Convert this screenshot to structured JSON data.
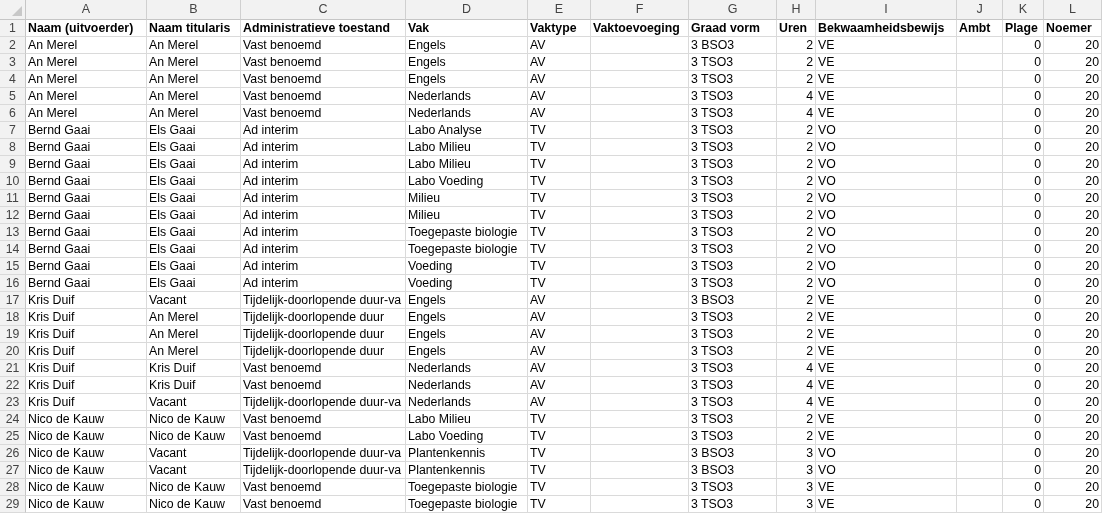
{
  "columns": [
    {
      "letter": "A",
      "heading": "Naam (uitvoerder)",
      "kind": "text"
    },
    {
      "letter": "B",
      "heading": "Naam titularis",
      "kind": "text"
    },
    {
      "letter": "C",
      "heading": "Administratieve toestand",
      "kind": "text"
    },
    {
      "letter": "D",
      "heading": "Vak",
      "kind": "text"
    },
    {
      "letter": "E",
      "heading": "Vaktype",
      "kind": "text"
    },
    {
      "letter": "F",
      "heading": "Vaktoevoeging",
      "kind": "text"
    },
    {
      "letter": "G",
      "heading": "Graad vorm",
      "kind": "text"
    },
    {
      "letter": "H",
      "heading": "Uren",
      "kind": "number"
    },
    {
      "letter": "I",
      "heading": "Bekwaamheidsbewijs",
      "kind": "text"
    },
    {
      "letter": "J",
      "heading": "Ambt",
      "kind": "text"
    },
    {
      "letter": "K",
      "heading": "Plage",
      "kind": "number"
    },
    {
      "letter": "L",
      "heading": "Noemer",
      "kind": "number"
    }
  ],
  "heading_row_number": "1",
  "rows": [
    {
      "number": "2",
      "cells": [
        "An Merel",
        "An Merel",
        "Vast benoemd",
        "Engels",
        "AV",
        null,
        "3 BSO3",
        "2",
        "VE",
        null,
        "0",
        "20"
      ]
    },
    {
      "number": "3",
      "cells": [
        "An Merel",
        "An Merel",
        "Vast benoemd",
        "Engels",
        "AV",
        null,
        "3 TSO3",
        "2",
        "VE",
        null,
        "0",
        "20"
      ]
    },
    {
      "number": "4",
      "cells": [
        "An Merel",
        "An Merel",
        "Vast benoemd",
        "Engels",
        "AV",
        null,
        "3 TSO3",
        "2",
        "VE",
        null,
        "0",
        "20"
      ]
    },
    {
      "number": "5",
      "cells": [
        "An Merel",
        "An Merel",
        "Vast benoemd",
        "Nederlands",
        "AV",
        null,
        "3 TSO3",
        "4",
        "VE",
        null,
        "0",
        "20"
      ]
    },
    {
      "number": "6",
      "cells": [
        "An Merel",
        "An Merel",
        "Vast benoemd",
        "Nederlands",
        "AV",
        null,
        "3 TSO3",
        "4",
        "VE",
        null,
        "0",
        "20"
      ]
    },
    {
      "number": "7",
      "cells": [
        "Bernd Gaai",
        "Els Gaai",
        "Ad interim",
        "Labo Analyse",
        "TV",
        null,
        "3 TSO3",
        "2",
        "VO",
        null,
        "0",
        "20"
      ]
    },
    {
      "number": "8",
      "cells": [
        "Bernd Gaai",
        "Els Gaai",
        "Ad interim",
        "Labo Milieu",
        "TV",
        null,
        "3 TSO3",
        "2",
        "VO",
        null,
        "0",
        "20"
      ]
    },
    {
      "number": "9",
      "cells": [
        "Bernd Gaai",
        "Els Gaai",
        "Ad interim",
        "Labo Milieu",
        "TV",
        null,
        "3 TSO3",
        "2",
        "VO",
        null,
        "0",
        "20"
      ]
    },
    {
      "number": "10",
      "cells": [
        "Bernd Gaai",
        "Els Gaai",
        "Ad interim",
        "Labo Voeding",
        "TV",
        null,
        "3 TSO3",
        "2",
        "VO",
        null,
        "0",
        "20"
      ]
    },
    {
      "number": "11",
      "cells": [
        "Bernd Gaai",
        "Els Gaai",
        "Ad interim",
        "Milieu",
        "TV",
        null,
        "3 TSO3",
        "2",
        "VO",
        null,
        "0",
        "20"
      ]
    },
    {
      "number": "12",
      "cells": [
        "Bernd Gaai",
        "Els Gaai",
        "Ad interim",
        "Milieu",
        "TV",
        null,
        "3 TSO3",
        "2",
        "VO",
        null,
        "0",
        "20"
      ]
    },
    {
      "number": "13",
      "cells": [
        "Bernd Gaai",
        "Els Gaai",
        "Ad interim",
        "Toegepaste biologie",
        "TV",
        null,
        "3 TSO3",
        "2",
        "VO",
        null,
        "0",
        "20"
      ]
    },
    {
      "number": "14",
      "cells": [
        "Bernd Gaai",
        "Els Gaai",
        "Ad interim",
        "Toegepaste biologie",
        "TV",
        null,
        "3 TSO3",
        "2",
        "VO",
        null,
        "0",
        "20"
      ]
    },
    {
      "number": "15",
      "cells": [
        "Bernd Gaai",
        "Els Gaai",
        "Ad interim",
        "Voeding",
        "TV",
        null,
        "3 TSO3",
        "2",
        "VO",
        null,
        "0",
        "20"
      ]
    },
    {
      "number": "16",
      "cells": [
        "Bernd Gaai",
        "Els Gaai",
        "Ad interim",
        "Voeding",
        "TV",
        null,
        "3 TSO3",
        "2",
        "VO",
        null,
        "0",
        "20"
      ]
    },
    {
      "number": "17",
      "cells": [
        "Kris Duif",
        "Vacant",
        "Tijdelijk-doorlopende duur-va",
        "Engels",
        "AV",
        null,
        "3 BSO3",
        "2",
        "VE",
        null,
        "0",
        "20"
      ]
    },
    {
      "number": "18",
      "cells": [
        "Kris Duif",
        "An Merel",
        "Tijdelijk-doorlopende duur",
        "Engels",
        "AV",
        null,
        "3 TSO3",
        "2",
        "VE",
        null,
        "0",
        "20"
      ]
    },
    {
      "number": "19",
      "cells": [
        "Kris Duif",
        "An Merel",
        "Tijdelijk-doorlopende duur",
        "Engels",
        "AV",
        null,
        "3 TSO3",
        "2",
        "VE",
        null,
        "0",
        "20"
      ]
    },
    {
      "number": "20",
      "cells": [
        "Kris Duif",
        "An Merel",
        "Tijdelijk-doorlopende duur",
        "Engels",
        "AV",
        null,
        "3 TSO3",
        "2",
        "VE",
        null,
        "0",
        "20"
      ]
    },
    {
      "number": "21",
      "cells": [
        "Kris Duif",
        "Kris Duif",
        "Vast benoemd",
        "Nederlands",
        "AV",
        null,
        "3 TSO3",
        "4",
        "VE",
        null,
        "0",
        "20"
      ]
    },
    {
      "number": "22",
      "cells": [
        "Kris Duif",
        "Kris Duif",
        "Vast benoemd",
        "Nederlands",
        "AV",
        null,
        "3 TSO3",
        "4",
        "VE",
        null,
        "0",
        "20"
      ]
    },
    {
      "number": "23",
      "cells": [
        "Kris Duif",
        "Vacant",
        "Tijdelijk-doorlopende duur-va",
        "Nederlands",
        "AV",
        null,
        "3 TSO3",
        "4",
        "VE",
        null,
        "0",
        "20"
      ]
    },
    {
      "number": "24",
      "cells": [
        "Nico de Kauw",
        "Nico de Kauw",
        "Vast benoemd",
        "Labo Milieu",
        "TV",
        null,
        "3 TSO3",
        "2",
        "VE",
        null,
        "0",
        "20"
      ]
    },
    {
      "number": "25",
      "cells": [
        "Nico de Kauw",
        "Nico de Kauw",
        "Vast benoemd",
        "Labo Voeding",
        "TV",
        null,
        "3 TSO3",
        "2",
        "VE",
        null,
        "0",
        "20"
      ]
    },
    {
      "number": "26",
      "cells": [
        "Nico de Kauw",
        "Vacant",
        "Tijdelijk-doorlopende duur-va",
        "Plantenkennis",
        "TV",
        null,
        "3 BSO3",
        "3",
        "VO",
        null,
        "0",
        "20"
      ]
    },
    {
      "number": "27",
      "cells": [
        "Nico de Kauw",
        "Vacant",
        "Tijdelijk-doorlopende duur-va",
        "Plantenkennis",
        "TV",
        null,
        "3 BSO3",
        "3",
        "VO",
        null,
        "0",
        "20"
      ]
    },
    {
      "number": "28",
      "cells": [
        "Nico de Kauw",
        "Nico de Kauw",
        "Vast benoemd",
        "Toegepaste biologie",
        "TV",
        null,
        "3 TSO3",
        "3",
        "VE",
        null,
        "0",
        "20"
      ]
    },
    {
      "number": "29",
      "cells": [
        "Nico de Kauw",
        "Nico de Kauw",
        "Vast benoemd",
        "Toegepaste biologie",
        "TV",
        null,
        "3 TSO3",
        "3",
        "VE",
        null,
        "0",
        "20"
      ]
    }
  ]
}
